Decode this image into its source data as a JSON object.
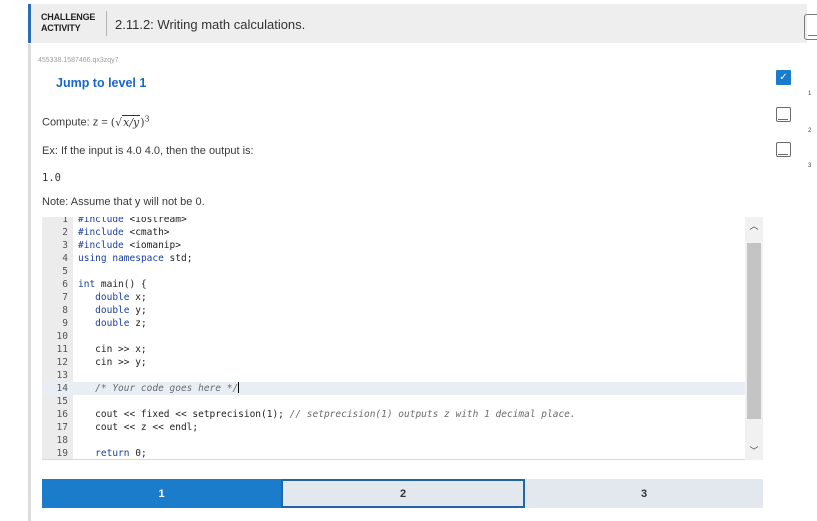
{
  "header": {
    "activity_label": "CHALLENGE ACTIVITY",
    "title": "2.11.2: Writing math calculations."
  },
  "activity_id": "455338.1587466.qx3zqy7",
  "jump_link": "Jump to level 1",
  "prompt": {
    "compute_label": "Compute: z =",
    "example": "Ex: If the input is 4.0 4.0, then the output is:",
    "example_output": "1.0",
    "note": "Note: Assume that y will not be 0."
  },
  "code": {
    "line_numbers": [
      "1",
      "2",
      "3",
      "4",
      "5",
      "6",
      "7",
      "8",
      "9",
      "10",
      "11",
      "12",
      "13",
      "14",
      "15",
      "16",
      "17",
      "18",
      "19"
    ],
    "lines": [
      "#include <iostream>",
      "#include <cmath>",
      "#include <iomanip>",
      "using namespace std;",
      "",
      "int main() {",
      "   double x;",
      "   double y;",
      "   double z;",
      "",
      "   cin >> x;",
      "   cin >> y;",
      "",
      "   /* Your code goes here */",
      "",
      "   cout << fixed << setprecision(1); // setprecision(1) outputs z with 1 decimal place.",
      "   cout << z << endl;",
      "",
      "   return 0;"
    ]
  },
  "levels": [
    {
      "label": "1",
      "state": "active"
    },
    {
      "label": "2",
      "state": "focused"
    },
    {
      "label": "3",
      "state": "default"
    }
  ],
  "side_progress": [
    {
      "num": "1",
      "status": "complete"
    },
    {
      "num": "2",
      "status": "incomplete"
    },
    {
      "num": "3",
      "status": "incomplete"
    }
  ],
  "colors": {
    "accent": "#1a7ccb",
    "link": "#1967c8",
    "header_border": "#2a6db5"
  }
}
